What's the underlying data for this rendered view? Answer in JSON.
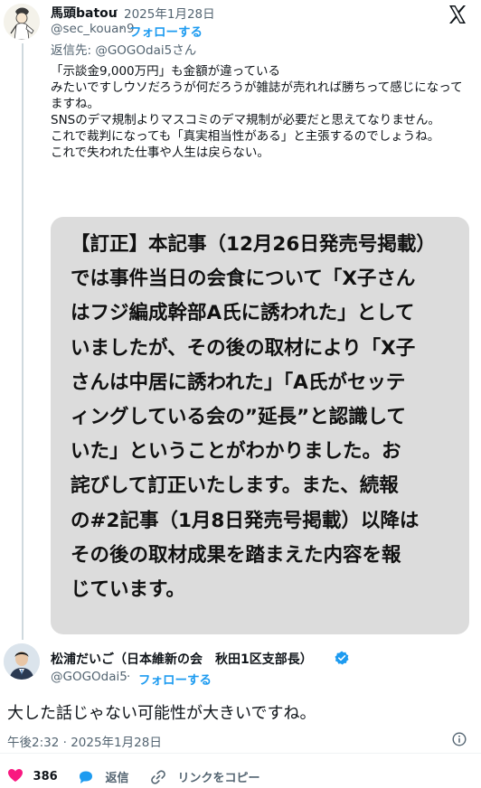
{
  "tweet1": {
    "display_name": "馬頭batou",
    "date_sep": " · ",
    "date": "2025年1月28日",
    "handle": "@sec_kouan9",
    "follow_label": "フォローする",
    "reply_to": "返信先: @GOGOdai5さん",
    "body": "「示談金9,000万円」も金額が違っている\nみたいですしウソだろうが何だろうが雑誌が売れれば勝ちって感じになってますね。\nSNSのデマ規制よりマスコミのデマ規制が必要だと思えてなりません。\nこれで裁判になっても「真実相当性がある」と主張するのでしょうね。\nこれで失われた仕事や人生は戻らない。",
    "quote_text": "【訂正】本記事（12月26日発売号掲載）\nでは事件当日の会食について「X子さん\nはフジ編成幹部A氏に誘われた」として\nいましたが、その後の取材により「X子\nさんは中居に誘われた」「A氏がセッテ\nィングしている会の”延長”と認識して\nいた」ということがわかりました。お\n詫びして訂正いたします。また、続報\nの#2記事（1月8日発売号掲載）以降は\nその後の取材成果を踏まえた内容を報\nじています。"
  },
  "tweet2": {
    "display_name": "松浦だいご（日本維新の会　秋田1区支部長）",
    "handle": "@GOGOdai5",
    "dot": " · ",
    "follow_label": "フォローする",
    "body": "大した話じゃない可能性が大きいですね。",
    "timestamp": "午後2:32 · 2025年1月28日",
    "likes": "386",
    "reply_label": "返信",
    "copy_link_label": "リンクをコピー"
  },
  "icons": {
    "x_logo": "x-logo-icon",
    "verified": "verified-badge-icon",
    "info": "info-icon",
    "heart": "heart-icon",
    "reply": "reply-icon",
    "link": "link-icon"
  },
  "colors": {
    "accent": "#1d9bf0",
    "like": "#f91880",
    "muted": "#536471",
    "quote_bg": "#dcdcdc"
  }
}
